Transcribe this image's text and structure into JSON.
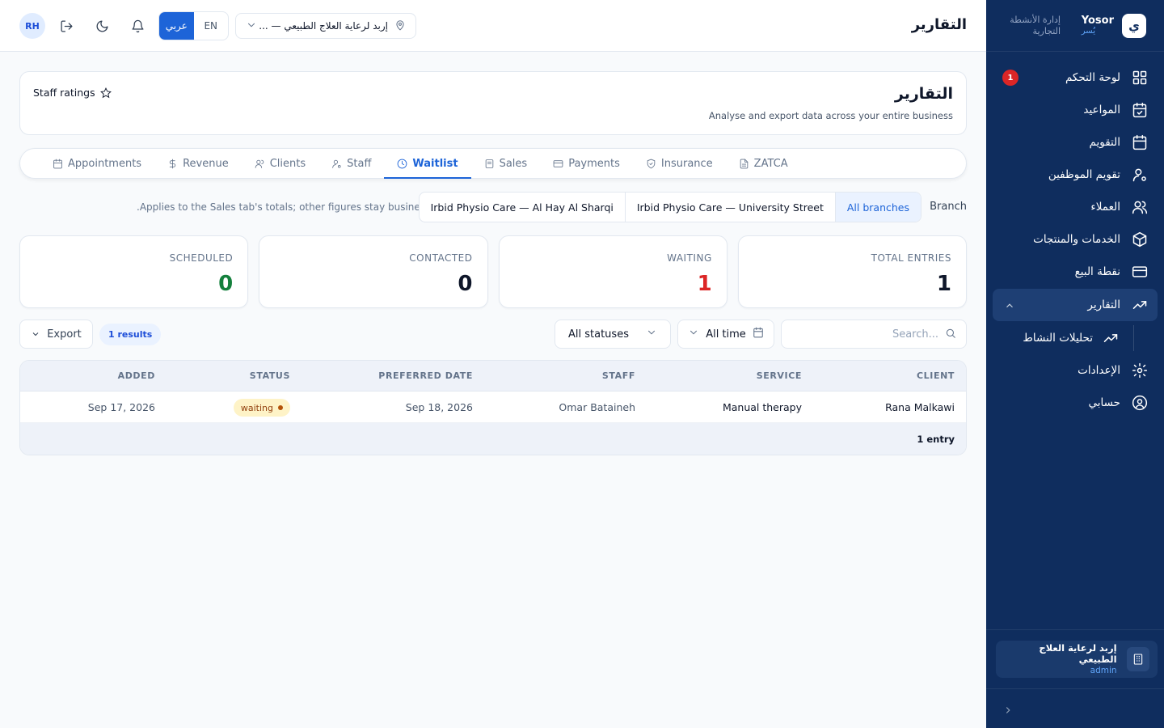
{
  "brand": {
    "name_en": "Yosor",
    "name_ar": "يُسر",
    "logo_letter": "ي",
    "subtitle": "إدارة الأنشطة التجارية"
  },
  "sidebar": {
    "items": [
      {
        "label": "لوحة التحكم",
        "icon": "grid-icon",
        "badge": "1"
      },
      {
        "label": "المواعيد",
        "icon": "calendar-check-icon"
      },
      {
        "label": "التقويم",
        "icon": "calendar-icon"
      },
      {
        "label": "تقويم الموظفين",
        "icon": "user-cog-icon"
      },
      {
        "label": "العملاء",
        "icon": "users-icon"
      },
      {
        "label": "الخدمات والمنتجات",
        "icon": "package-icon"
      },
      {
        "label": "نقطة البيع",
        "icon": "credit-card-icon"
      },
      {
        "label": "التقارير",
        "icon": "trending-up-icon",
        "active": true
      },
      {
        "label": "تحليلات النشاط",
        "icon": "trending-up-icon",
        "sub": true
      },
      {
        "label": "الإعدادات",
        "icon": "gear-icon"
      },
      {
        "label": "حسابي",
        "icon": "user-circle-icon"
      }
    ],
    "org": {
      "name": "إربد لرعاية العلاج الطبيعي",
      "role": "admin"
    }
  },
  "topbar": {
    "title": "التقارير",
    "avatar": "RH",
    "lang": {
      "ar": "عربي",
      "en": "EN",
      "active": "ar"
    },
    "branch_select": "إربد لرعاية العلاج الطبيعي — ..."
  },
  "header": {
    "title": "التقارير",
    "subtitle": "Analyse and export data across your entire business",
    "staff_ratings": "Staff ratings"
  },
  "tabs": [
    {
      "label": "Appointments",
      "icon": "calendar-icon"
    },
    {
      "label": "Revenue",
      "icon": "dollar-icon"
    },
    {
      "label": "Clients",
      "icon": "users-icon"
    },
    {
      "label": "Staff",
      "icon": "user-cog-icon"
    },
    {
      "label": "Waitlist",
      "icon": "clock-icon",
      "active": true
    },
    {
      "label": "Sales",
      "icon": "receipt-icon"
    },
    {
      "label": "Payments",
      "icon": "credit-card-icon"
    },
    {
      "label": "Insurance",
      "icon": "shield-icon"
    },
    {
      "label": "ZATCA",
      "icon": "document-icon"
    }
  ],
  "branch_filter": {
    "label": "Branch",
    "note": ".Applies to the Sales tab's totals; other figures stay business-wide",
    "options": [
      "All branches",
      "Irbid Physio Care — University Street",
      "Irbid Physio Care — Al Hay Al Sharqi"
    ],
    "selected": "All branches"
  },
  "stats": [
    {
      "label": "TOTAL ENTRIES",
      "value": "1",
      "color": "#0f172a"
    },
    {
      "label": "WAITING",
      "value": "1",
      "color": "#dc2626"
    },
    {
      "label": "CONTACTED",
      "value": "0",
      "color": "#0f172a"
    },
    {
      "label": "SCHEDULED",
      "value": "0",
      "color": "#15803d"
    }
  ],
  "toolbar": {
    "search_placeholder": "Search...",
    "time": "All time",
    "status": "All statuses",
    "results": "1 results",
    "export": "Export"
  },
  "table": {
    "columns": [
      "CLIENT",
      "SERVICE",
      "STAFF",
      "PREFERRED DATE",
      "STATUS",
      "ADDED"
    ],
    "rows": [
      {
        "client": "Rana Malkawi",
        "service": "Manual therapy",
        "staff": "Omar Bataineh",
        "preferred_date": "Sep 18, 2026",
        "status": "waiting",
        "added": "Sep 17, 2026"
      }
    ],
    "footer": "1 entry"
  },
  "colors": {
    "sidebar": "#0f2d5e",
    "accent": "#1d64d8",
    "danger": "#dc2626",
    "success": "#15803d"
  }
}
